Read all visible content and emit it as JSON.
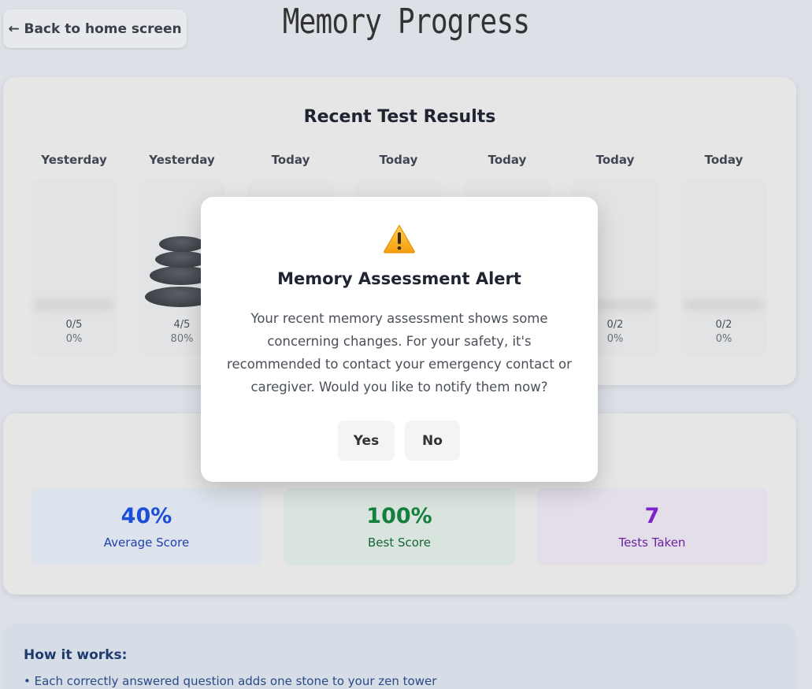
{
  "header": {
    "back_label": "← Back to home screen",
    "title": "Memory Progress"
  },
  "results": {
    "title": "Recent Test Results",
    "columns": [
      {
        "day": "Yesterday",
        "score": "0/5",
        "pct": "0%"
      },
      {
        "day": "Yesterday",
        "score": "4/5",
        "pct": "80%"
      },
      {
        "day": "Today",
        "score": "",
        "pct": ""
      },
      {
        "day": "Today",
        "score": "",
        "pct": ""
      },
      {
        "day": "Today",
        "score": "",
        "pct": ""
      },
      {
        "day": "Today",
        "score": "0/2",
        "pct": "0%"
      },
      {
        "day": "Today",
        "score": "0/2",
        "pct": "0%"
      }
    ]
  },
  "stats": {
    "average": {
      "value": "40%",
      "label": "Average Score"
    },
    "best": {
      "value": "100%",
      "label": "Best Score"
    },
    "tests": {
      "value": "7",
      "label": "Tests Taken"
    }
  },
  "how": {
    "title": "How it works:",
    "line1": "• Each correctly answered question adds one stone to your zen tower"
  },
  "modal": {
    "icon": "warning-icon",
    "title": "Memory Assessment Alert",
    "body": "Your recent memory assessment shows some concerning changes. For your safety, it's recommended to contact your emergency contact or caregiver. Would you like to notify them now?",
    "yes_label": "Yes",
    "no_label": "No"
  },
  "colors": {
    "average": "#1d4ed8",
    "best": "#15803d",
    "tests": "#7e22ce"
  }
}
